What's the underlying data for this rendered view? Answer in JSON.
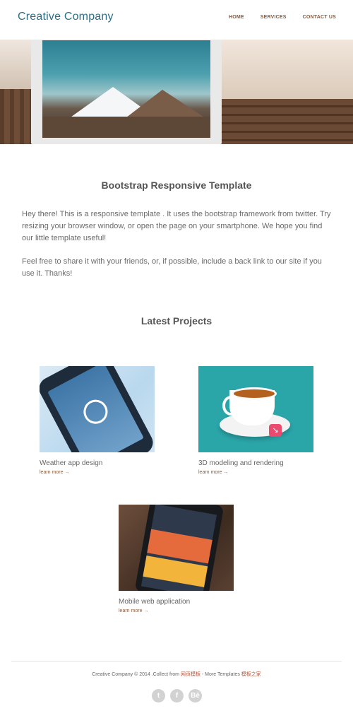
{
  "header": {
    "brand": "Creative Company",
    "nav": [
      "HOME",
      "SERVICES",
      "CONTACT US"
    ]
  },
  "intro": {
    "title": "Bootstrap Responsive Template",
    "paragraph1": "Hey there! This is a responsive template . It uses the bootstrap framework from twitter. Try resizing your browser window, or open the page on your smartphone. We hope you find our little template useful!",
    "paragraph2": "Feel free to share it with your friends, or, if possible, include a back link to our site if you use it. Thanks!"
  },
  "projects": {
    "title": "Latest Projects",
    "items": [
      {
        "title": "Weather app design",
        "more": "learn more →"
      },
      {
        "title": "3D modeling and rendering",
        "more": "learn more →"
      },
      {
        "title": "Mobile web application",
        "more": "learn more →"
      }
    ]
  },
  "footer": {
    "copyright": "Creative Company © 2014 .Collect from ",
    "link1": "网页模板",
    "sep": " - More Templates ",
    "link2": "模板之家",
    "social": [
      "twitter-icon",
      "facebook-icon",
      "behance-icon"
    ]
  },
  "colors": {
    "brand": "#2b6f87",
    "nav": "#8a5a3c",
    "link": "#b0553b"
  }
}
